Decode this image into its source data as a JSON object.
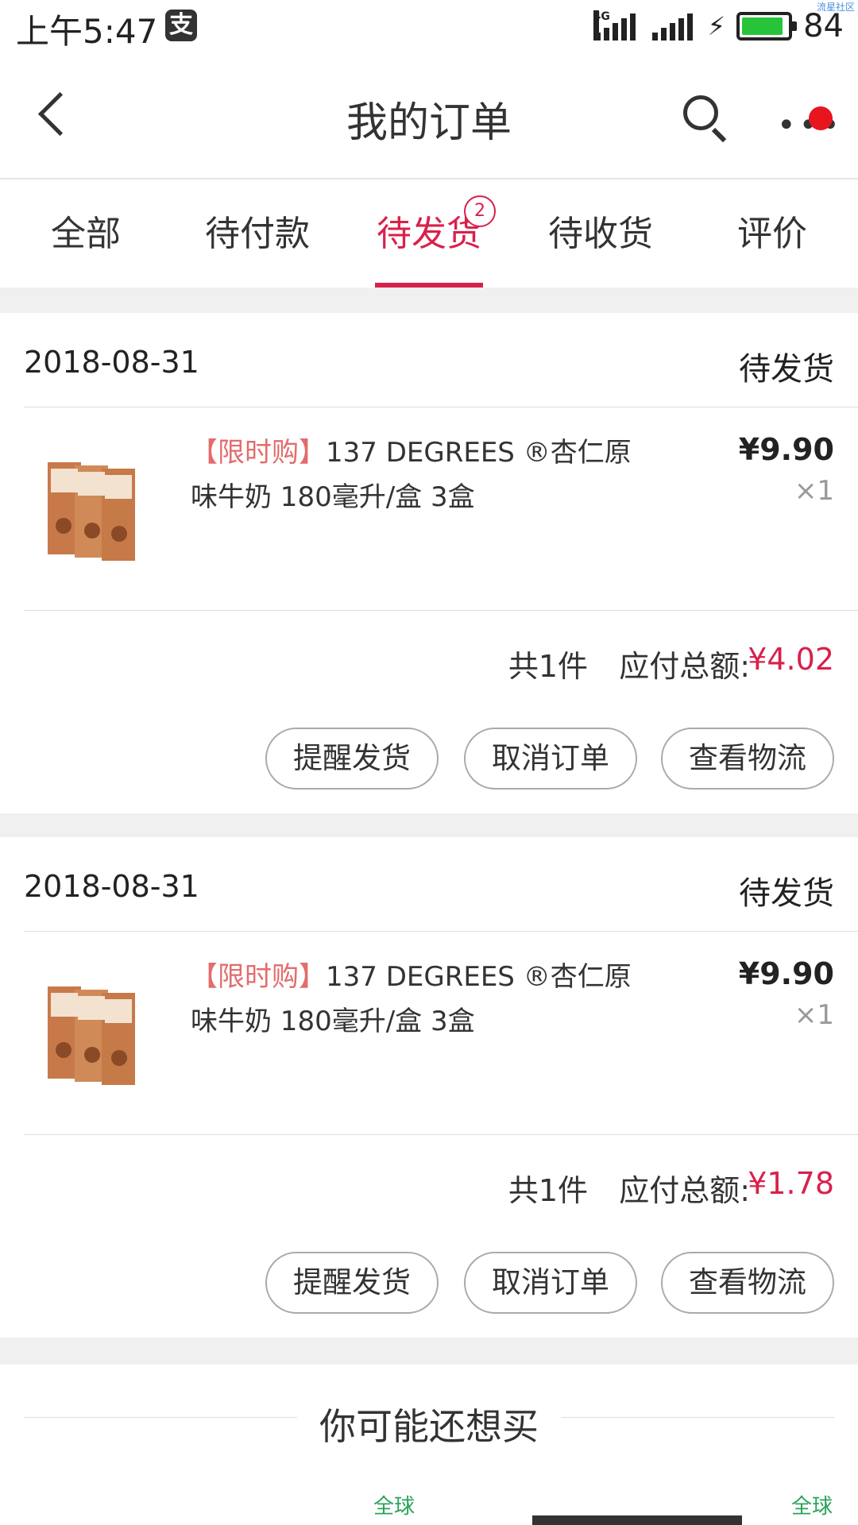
{
  "status_bar": {
    "time": "上午5:47",
    "pay_icon": "支",
    "network": "4G",
    "battery": "84",
    "watermark": "流星社区",
    "icons": [
      "alipay-icon",
      "signal-icon",
      "charging-icon",
      "battery-icon"
    ],
    "battery_level": 0.84
  },
  "header": {
    "title": "我的订单",
    "icons": [
      "back-icon",
      "search-icon",
      "more-icon"
    ]
  },
  "tabs": [
    {
      "label": "全部",
      "active": false
    },
    {
      "label": "待付款",
      "active": false
    },
    {
      "label": "待发货",
      "active": true,
      "badge": "2"
    },
    {
      "label": "待收货",
      "active": false
    },
    {
      "label": "评价",
      "active": false
    }
  ],
  "orders": [
    {
      "date": "2018-08-31",
      "status": "待发货",
      "product": {
        "tag": "【限时购】",
        "name": "137 DEGREES ®杏仁原味牛奶 180毫升/盒 3盒",
        "price": "¥9.90",
        "qty": "×1"
      },
      "count": "共1件",
      "total_label": "应付总额:",
      "total": "¥4.02",
      "buttons": [
        "提醒发货",
        "取消订单",
        "查看物流"
      ]
    },
    {
      "date": "2018-08-31",
      "status": "待发货",
      "product": {
        "tag": "【限时购】",
        "name": "137 DEGREES ®杏仁原味牛奶 180毫升/盒 3盒",
        "price": "¥9.90",
        "qty": "×1"
      },
      "count": "共1件",
      "total_label": "应付总额:",
      "total": "¥1.78",
      "buttons": [
        "提醒发货",
        "取消订单",
        "查看物流"
      ]
    }
  ],
  "recommend": {
    "title": "你可能还想买",
    "badges": [
      "全球",
      "全球"
    ]
  },
  "colors": {
    "accent": "#d8214a",
    "tag": "#e36c6c",
    "badge_green": "#2aa45a",
    "notify_dot": "#e8141e"
  }
}
